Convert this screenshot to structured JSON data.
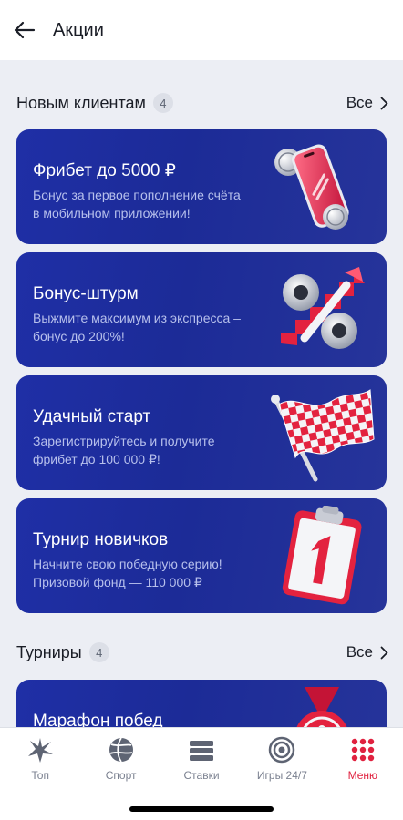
{
  "header": {
    "title": "Акции"
  },
  "sections": [
    {
      "title": "Новым клиентам",
      "count": "4",
      "all_label": "Все",
      "cards": [
        {
          "title": "Фрибет до 5000 ₽",
          "subtitle_line1": "Бонус за первое пополнение счёта",
          "subtitle_line2": "в мобильном приложении!",
          "art": "phone-coins-icon"
        },
        {
          "title": "Бонус-штурм",
          "subtitle_line1": "Выжмите максимум из экспресса –",
          "subtitle_line2": "бонус до 200%!",
          "art": "percent-icon"
        },
        {
          "title": "Удачный старт",
          "subtitle_line1": "Зарегистрируйтесь и получите",
          "subtitle_line2": "фрибет до 100 000 ₽!",
          "art": "checkered-flag-icon"
        },
        {
          "title": "Турнир новичков",
          "subtitle_line1": "Начните свою победную серию!",
          "subtitle_line2": "Призовой фонд — 110 000 ₽",
          "art": "clipboard-one-icon"
        }
      ]
    },
    {
      "title": "Турниры",
      "count": "4",
      "all_label": "Все",
      "cards": [
        {
          "title": "Марафон побед",
          "art": "medal-icon"
        }
      ]
    }
  ],
  "bottom_nav": [
    {
      "label": "Топ",
      "icon": "star-burst-icon"
    },
    {
      "label": "Спорт",
      "icon": "ball-icon"
    },
    {
      "label": "Ставки",
      "icon": "bets-icon"
    },
    {
      "label": "Игры 24/7",
      "icon": "target-icon"
    },
    {
      "label": "Меню",
      "icon": "grid-dots-icon",
      "active": true
    }
  ],
  "colors": {
    "card_bg": "#1f2fa6",
    "accent_red": "#e0213f",
    "page_bg": "#eceef4"
  }
}
